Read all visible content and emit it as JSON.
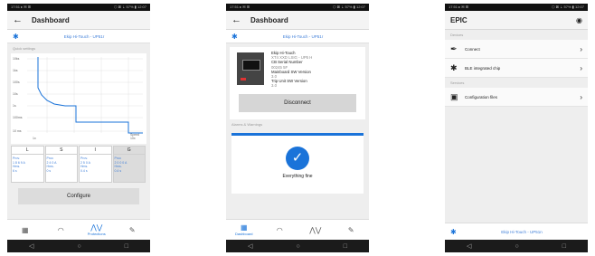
{
  "status": {
    "left": "17:51 ▸ ✉ ⊞",
    "right": "⬡ ⊠ ⇣ 57% ▮ 12:07"
  },
  "phone1": {
    "title": "Dashboard",
    "device": "Ekip Hi-Touch - UP51r",
    "section": "Quick settings",
    "y_ticks": [
      "10ks",
      "1ks",
      "100s",
      "10s",
      "1s",
      "100ms",
      "10 ms"
    ],
    "x_left": "1x",
    "x_right": "Speed\n10x",
    "tabs": [
      {
        "label": "L",
        "vals": [
          "Prov.",
          "1 8 6 9 A",
          "",
          "Hms.",
          "6 s"
        ]
      },
      {
        "label": "S",
        "vals": [
          "Prov.",
          "2 4 0 A",
          "",
          "Hms.",
          "0 s"
        ]
      },
      {
        "label": "I",
        "vals": [
          "Prov.",
          "2 5 0 A",
          "",
          "Hms.",
          "0.4 s"
        ]
      },
      {
        "label": "G",
        "vals": [
          "Prov.",
          "2 0 0 0 A",
          "",
          "Hms.",
          "0.4 s"
        ]
      }
    ],
    "configure": "Configure",
    "nav": [
      {
        "icon": "dashboard-icon",
        "label": ""
      },
      {
        "icon": "gauge-icon",
        "label": ""
      },
      {
        "icon": "protections-icon",
        "label": "Protections"
      },
      {
        "icon": "wrench-icon",
        "label": ""
      }
    ]
  },
  "phone2": {
    "title": "Dashboard",
    "device": "Ekip Hi-Touch - UP51r",
    "info": [
      {
        "label": "Ekip Hi-Touch",
        "value": "XT4 XXD LSIG - UP5 H"
      },
      {
        "label": "CB Serial Number",
        "value": "00245 5F"
      },
      {
        "label": "Mainboard SW Version",
        "value": "3.0"
      },
      {
        "label": "Trip Unit SW Version",
        "value": "3.0"
      }
    ],
    "disconnect": "Disconnect",
    "alarms_section": "Alarms & Warnings",
    "alarms_text": "Everything fine",
    "nav": [
      {
        "icon": "dashboard-icon",
        "label": "Dashboard"
      },
      {
        "icon": "gauge-icon",
        "label": ""
      },
      {
        "icon": "waveform-icon",
        "label": ""
      },
      {
        "icon": "wrench-icon",
        "label": ""
      }
    ]
  },
  "phone3": {
    "title": "EPIC",
    "devices_section": "Devices",
    "connect": "Connect",
    "ble": "BLE integrated chip",
    "services_section": "Services",
    "configuration": "Configuration files",
    "footer_device": "Ekip Hi-Touch - UP51n"
  },
  "colors": {
    "accent": "#1a73d9",
    "button": "#dcdcdc"
  }
}
